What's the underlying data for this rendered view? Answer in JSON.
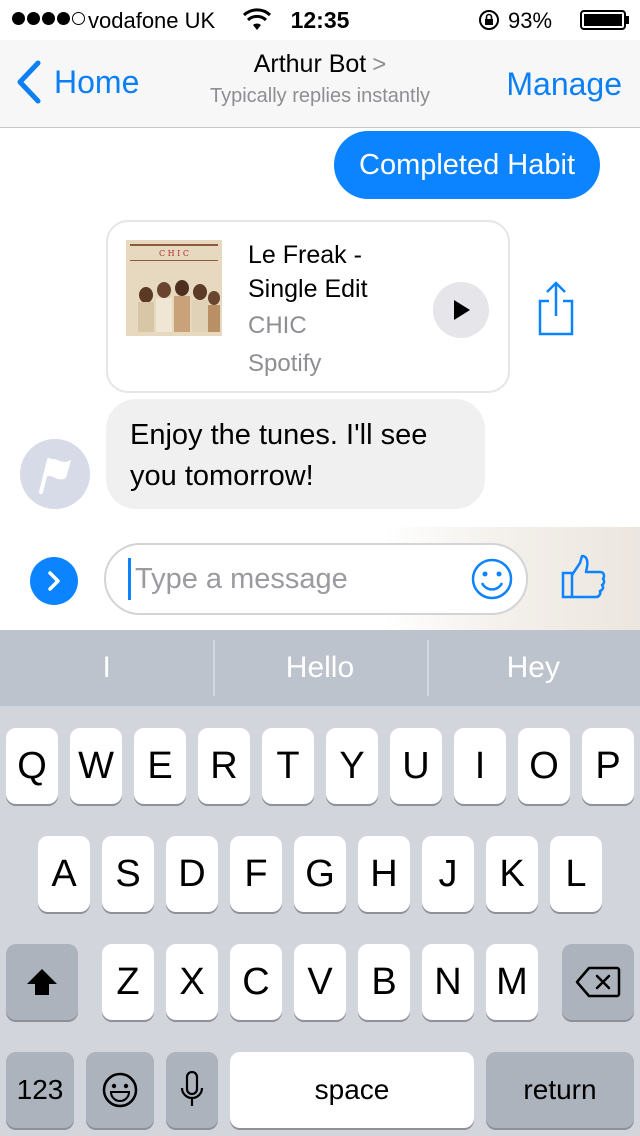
{
  "status_bar": {
    "carrier": "vodafone UK",
    "time": "12:35",
    "battery": "93%"
  },
  "nav": {
    "back_label": "Home",
    "title": "Arthur Bot",
    "title_chevron": ">",
    "subtitle": "Typically replies instantly",
    "manage_label": "Manage"
  },
  "messages": {
    "outgoing": "Completed Habit",
    "music_card": {
      "title": "Le Freak - Single Edit",
      "artist": "CHIC",
      "source": "Spotify",
      "album_text": "C H I C"
    },
    "incoming": "Enjoy the tunes. I'll see you tomorrow!"
  },
  "composer": {
    "placeholder": "Type a message"
  },
  "predictive": [
    "I",
    "Hello",
    "Hey"
  ],
  "keyboard": {
    "row1": [
      "Q",
      "W",
      "E",
      "R",
      "T",
      "Y",
      "U",
      "I",
      "O",
      "P"
    ],
    "row2": [
      "A",
      "S",
      "D",
      "F",
      "G",
      "H",
      "J",
      "K",
      "L"
    ],
    "row3": [
      "Z",
      "X",
      "C",
      "V",
      "B",
      "N",
      "M"
    ],
    "numbers_label": "123",
    "space_label": "space",
    "return_label": "return"
  },
  "colors": {
    "accent": "#0d84ff",
    "incoming_bubble": "#f1f0f0",
    "keyboard_bg": "#d2d6dc"
  },
  "icons": {
    "wifi": "wifi-icon",
    "lock": "orientation-lock-icon",
    "battery": "battery-icon",
    "back": "chevron-left-icon",
    "play": "play-icon",
    "share": "share-icon",
    "avatar": "flag-icon",
    "expand": "chevron-right-icon",
    "emoji": "smiley-icon",
    "like": "thumbs-up-icon",
    "shift": "shift-icon",
    "delete": "backspace-icon",
    "emoji_key": "emoji-icon",
    "mic": "microphone-icon"
  }
}
